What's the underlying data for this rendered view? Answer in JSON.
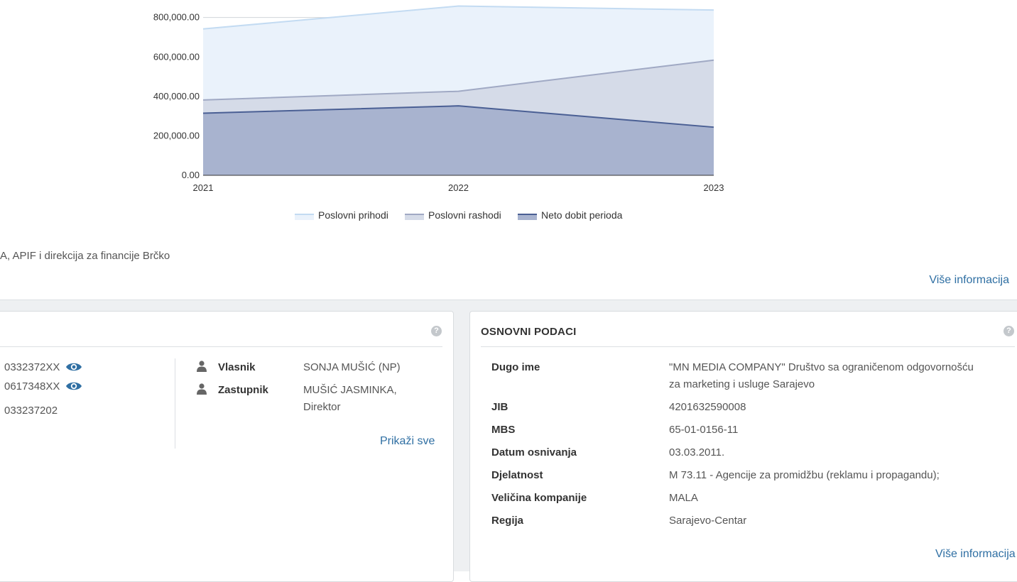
{
  "chart_data": {
    "type": "area",
    "x": [
      "2021",
      "2022",
      "2023"
    ],
    "series": [
      {
        "name": "Poslovni prihodi",
        "values": [
          742000,
          858000,
          838000
        ],
        "color": "#c3dbf2",
        "fill": "#eaf2fb"
      },
      {
        "name": "Poslovni rashodi",
        "values": [
          382000,
          426000,
          584000
        ],
        "color": "#a0a9c4",
        "fill": "#d5dbe8"
      },
      {
        "name": "Neto dobit perioda",
        "values": [
          315000,
          352000,
          244000
        ],
        "color": "#4a5f94",
        "fill": "#a8b3cf"
      }
    ],
    "ylim": [
      0,
      860000
    ],
    "yticks": [
      "0.00",
      "200,000.00",
      "400,000.00",
      "600,000.00",
      "800,000.00"
    ],
    "ytick_values": [
      0,
      200000,
      400000,
      600000,
      800000
    ],
    "grid": true,
    "legend": "bottom"
  },
  "source_note": "A, APIF i direkcija za financije Brčko",
  "top_more_link": "Više informacija",
  "contact_card": {
    "phones": [
      {
        "value": "0332372XX"
      },
      {
        "value": "0617348XX"
      }
    ],
    "fax": "033237202",
    "people": [
      {
        "role": "Vlasnik",
        "value": "SONJA MUŠIĆ (NP)"
      },
      {
        "role": "Zastupnik",
        "value_line1": "MUŠIĆ JASMINKA,",
        "value_line2": "Direktor"
      }
    ],
    "show_all": "Prikaži sve",
    "help": "?"
  },
  "basic_card": {
    "title": "OSNOVNI PODACI",
    "help": "?",
    "rows": [
      {
        "label": "Dugo ime",
        "value_line1": "\"MN MEDIA COMPANY\" Društvo sa ograničenom odgovornošću",
        "value_line2": "za marketing i usluge Sarajevo"
      },
      {
        "label": "JIB",
        "value": "4201632590008"
      },
      {
        "label": "MBS",
        "value": "65-01-0156-11"
      },
      {
        "label": "Datum osnivanja",
        "value": "03.03.2011."
      },
      {
        "label": "Djelatnost",
        "value": "M 73.11 - Agencije za promidžbu (reklamu i propagandu);"
      },
      {
        "label": "Veličina kompanije",
        "value": "MALA"
      },
      {
        "label": "Regija",
        "value": "Sarajevo-Centar"
      }
    ],
    "more_link": "Više informacija"
  }
}
